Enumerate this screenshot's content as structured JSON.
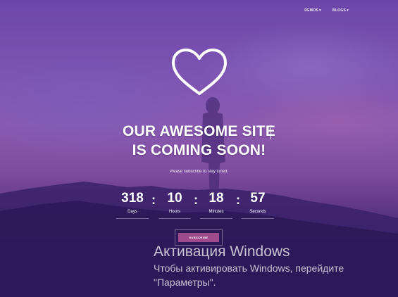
{
  "nav": {
    "items": [
      {
        "label": "DEMOS",
        "caret": "▾"
      },
      {
        "label": "BLOGS",
        "caret": "▾"
      }
    ]
  },
  "hero": {
    "icon": "heart-outline-icon",
    "title_line1": "OUR  AWESOME SITE",
    "title_line2": "IS COMING SOON!",
    "subtitle": "Please subscribe to stay tuned."
  },
  "countdown": {
    "separator": ":",
    "units": [
      {
        "value": "318",
        "label": "Days"
      },
      {
        "value": "10",
        "label": "Hours"
      },
      {
        "value": "18",
        "label": "Minutes"
      },
      {
        "value": "57",
        "label": "Seconds"
      }
    ]
  },
  "subscribe": {
    "label": "SUBSCRIBE",
    "color": "#a04a8e"
  },
  "windows_activation": {
    "title": "Активация Windows",
    "line1": "Чтобы активировать Windows, перейдите",
    "line2": "\"Параметры\"."
  }
}
